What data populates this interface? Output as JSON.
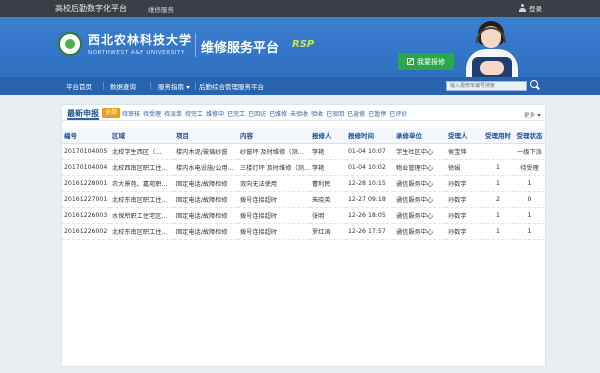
{
  "topbar": {
    "system_title": "高校后勤数字化平台",
    "system_link": "维修服务",
    "login": "登录"
  },
  "header": {
    "university_cn": "西北农林科技大学",
    "university_en": "NORTHWEST A&F UNIVERSITY",
    "platform_title": "维修服务平台",
    "brand_tag": "RSP",
    "repair_button": "我要报修"
  },
  "nav": {
    "items": [
      "平台首页",
      "数据查询",
      "服务指南",
      "后勤综合管理服务平台"
    ],
    "search_placeholder": "输入报修单编号搜索"
  },
  "panel": {
    "title": "最新申报",
    "active_tab": "全部",
    "tabs": [
      "待审核",
      "待受理",
      "待派单",
      "待完工",
      "维修中",
      "已完工",
      "已回访",
      "已维修",
      "未验收",
      "验收",
      "已驳回",
      "已返修",
      "已暂停",
      "已评价"
    ],
    "more": "更多"
  },
  "table": {
    "headers": [
      "编号",
      "区域",
      "项目",
      "内容",
      "报修人",
      "报修时间",
      "承修单位",
      "受理人",
      "受理用时",
      "受理状态"
    ],
    "rows": [
      [
        "20170104005",
        "北校学生西区（…",
        "楼内木泥/玻璃纱窗",
        "纱窗坏 及时维修（测…",
        "李艳",
        "01-04 10:07",
        "学生社区中心",
        "侯宝萍",
        "",
        "一级下派"
      ],
      [
        "20170104004",
        "北校西南区职工住…",
        "楼内水电设施/公用…",
        "三楼灯坏 及时维修（测…",
        "李艳",
        "01-04 10:02",
        "物业管理中心",
        "徐娟",
        "1",
        "待受理"
      ],
      [
        "20161228001",
        "农大景苑、嘉苑职…",
        "固定电话/故障检修",
        "双向无法使用",
        "曹利民",
        "12-28 10:15",
        "通信服务中心",
        "孙数字",
        "1",
        "1"
      ],
      [
        "20161227001",
        "北校东南区职工住…",
        "固定电话/故障检修",
        "拨号连接超时",
        "朱晓英",
        "12-27 09:18",
        "通信服务中心",
        "孙数字",
        "2",
        "0"
      ],
      [
        "20161226003",
        "水保所职工住宅区…",
        "固定电话/故障检修",
        "拨号连接超时",
        "张明",
        "12-26 18:05",
        "通信服务中心",
        "孙数字",
        "1",
        "1"
      ],
      [
        "20161226002",
        "北校东南区职工住…",
        "固定电话/故障检修",
        "拨号连接超时",
        "罗红涛",
        "12-26 17:57",
        "通信服务中心",
        "孙数字",
        "1",
        "1"
      ]
    ]
  },
  "colors": {
    "header_blue": "#2f6fc0",
    "nav_blue": "#2a63ad",
    "accent_orange": "#f39a1e",
    "button_green": "#29a84a",
    "status_red": "#e02020"
  },
  "icons": [
    "user-icon",
    "edit-icon",
    "search-icon",
    "caret-down-icon",
    "university-seal"
  ]
}
